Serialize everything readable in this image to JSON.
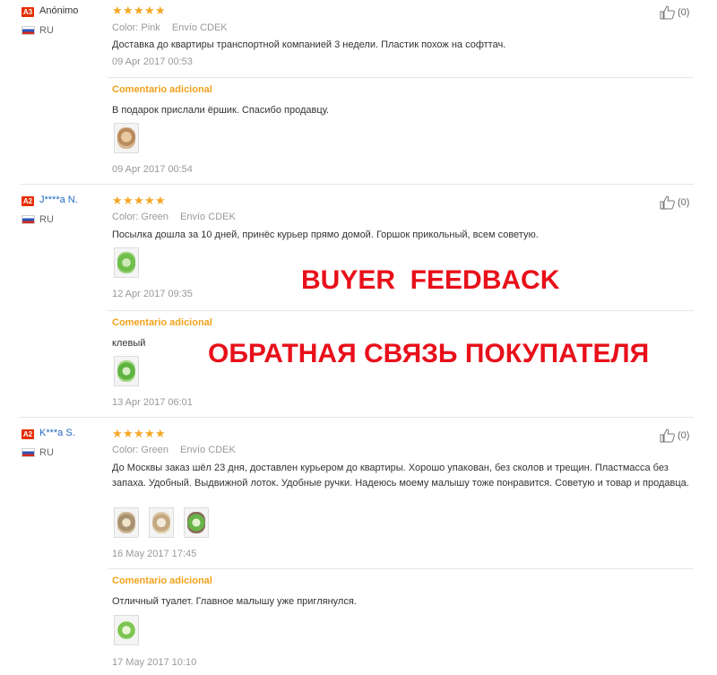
{
  "labels": {
    "color": "Color:",
    "shipping": "Envío",
    "additional": "Comentario adicional"
  },
  "reviews": [
    {
      "level": "A3",
      "user": "Anónimo",
      "country": "RU",
      "rating": 5,
      "color": "Pink",
      "shipping": "CDEK",
      "text": "Доставка до квартиры транспортной компанией 3 недели. Пластик похож на софттач.",
      "date": "09 Apr 2017 00:53",
      "helpful": "(0)",
      "additional": {
        "text": "В подарок прислали ёршик. Спасибо продавцу.",
        "images": [
          "pink-toilet-brush-photo"
        ],
        "date": "09 Apr 2017 00:54"
      }
    },
    {
      "level": "A2",
      "user": "J****a N.",
      "country": "RU",
      "rating": 5,
      "color": "Green",
      "shipping": "CDEK",
      "text": "Посылка дошла за 10 дней, принёс курьер прямо домой. Горшок прикольный, всем советую.",
      "images": [
        "green-potty-photo"
      ],
      "date": "12 Apr 2017 09:35",
      "helpful": "(0)",
      "additional": {
        "text": "клевый",
        "images": [
          "green-potty-photo"
        ],
        "date": "13 Apr 2017 06:01"
      }
    },
    {
      "level": "A2",
      "user": "K***a S.",
      "country": "RU",
      "rating": 5,
      "color": "Green",
      "shipping": "CDEK",
      "text": "До Москвы заказ шёл 23 дня, доставлен курьером до квартиры. Хорошо упакован, без сколов и трещин. Пластмасса без запаха. Удобный. Выдвижной лоток. Удобные ручки. Надеюсь моему малышу тоже понравится. Советую и товар и продавца.",
      "images": [
        "potty-photo-1",
        "potty-photo-2",
        "potty-photo-3"
      ],
      "date": "16 May 2017 17:45",
      "helpful": "(0)",
      "additional": {
        "text": "Отличный туалет. Главное малышу уже приглянулся.",
        "images": [
          "green-potty-photo"
        ],
        "date": "17 May 2017 10:10"
      }
    }
  ],
  "overlay": {
    "line1": "BUYER  FEEDBACK",
    "line2": "ОБРАТНАЯ СВЯЗЬ ПОКУПАТЕЛЯ"
  },
  "colors": {
    "star": "#f5a623",
    "additional_label": "#f0a21c",
    "overlay_text": "#e8101a",
    "level_badge": "#e62e04",
    "user_link": "#2469c3"
  },
  "icons": {
    "rating": "star-icon",
    "helpful": "thumbs-up-icon",
    "country": "russia-flag-icon"
  }
}
